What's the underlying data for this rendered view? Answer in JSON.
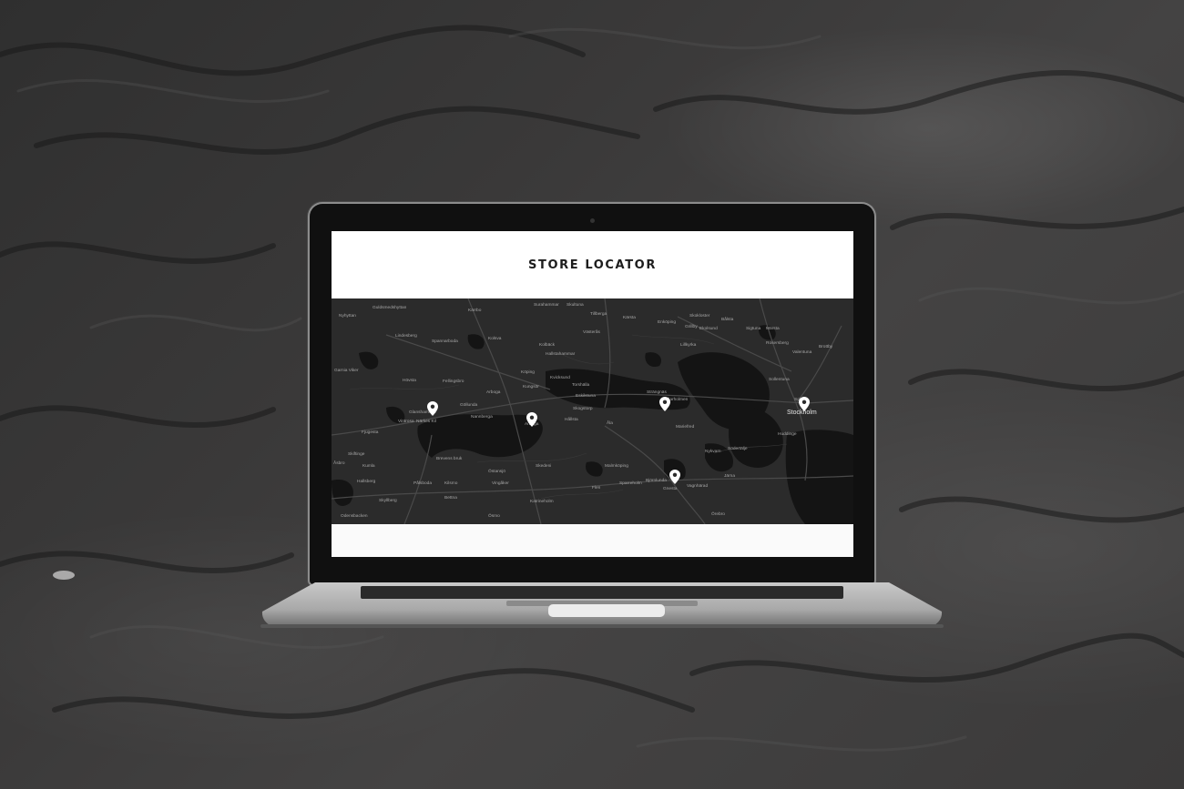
{
  "page": {
    "title": "STORE LOCATOR"
  },
  "map": {
    "city_labels": [
      "Nyhyttan",
      "Guldsmedshyttan",
      "Kärrbo",
      "Surahammar",
      "Skultuna",
      "Tillberga",
      "Kärsta",
      "Enköping",
      "Bålsta",
      "Sigtuna",
      "Märsta",
      "Rosersberg",
      "Valentuna",
      "Brottby",
      "Lindesberg",
      "Spannarboda",
      "Kolsva",
      "Västerås",
      "Kolbäck",
      "Lillkyrka",
      "Skokloster",
      "Grillby",
      "Ekolsund",
      "Garnia Viker",
      "Fellingsbro",
      "Arboga",
      "Kungsör",
      "Köping",
      "Hallstahammar",
      "Torshälla",
      "Eskilstuna",
      "Kvicksund",
      "Strängnäs",
      "Stallarholmen",
      "Mariefred",
      "Sollentuna",
      "Solna",
      "Stockholm",
      "Huddinge",
      "Södertälje",
      "Nykvarn",
      "Järna",
      "Hövsta",
      "Glanshammar",
      "Göllunda",
      "Närkes Kil",
      "Nannberga",
      "Arboga",
      "Skogstorp",
      "Hållsta",
      "Åla",
      "Kumla",
      "Hallsberg",
      "Pålsboda",
      "Kilsmo",
      "Östansjö",
      "Vingåker",
      "Katrineholm",
      "Flen",
      "Malmköping",
      "Sparreholm",
      "Björnlunda",
      "Gnesta",
      "Vagnhärad",
      "Örebro",
      "Vintrosa",
      "Fjugesta",
      "Skiftinge",
      "Åsbro",
      "Skyllberg",
      "Odensbacken",
      "Brevens bruk",
      "Bettna",
      "Skedeni",
      "Ösmo"
    ],
    "featured_label": "Stockholm",
    "store_pins": [
      {
        "name": "Glanshammar"
      },
      {
        "name": "Arboga"
      },
      {
        "name": "Stallarholmen"
      },
      {
        "name": "Stockholm"
      },
      {
        "name": "Björnlunda"
      }
    ]
  }
}
